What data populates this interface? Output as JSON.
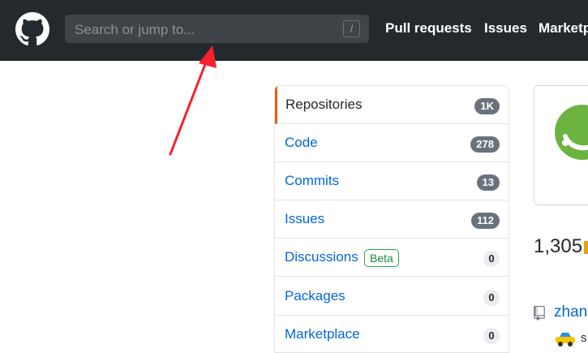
{
  "header": {
    "search_placeholder": "Search or jump to...",
    "search_shortcut": "/",
    "nav": [
      "Pull requests",
      "Issues",
      "Marketplace"
    ]
  },
  "filter_menu": {
    "items": [
      {
        "label": "Repositories",
        "count": "1K",
        "selected": true
      },
      {
        "label": "Code",
        "count": "278"
      },
      {
        "label": "Commits",
        "count": "13"
      },
      {
        "label": "Issues",
        "count": "112"
      },
      {
        "label": "Discussions",
        "badge": "Beta",
        "count": "0"
      },
      {
        "label": "Packages",
        "count": "0"
      },
      {
        "label": "Marketplace",
        "count": "0"
      }
    ]
  },
  "results": {
    "count_text": "1,305",
    "first_repo": "zhan",
    "first_repo_desc": "s"
  },
  "colors": {
    "header_bg": "#24292e",
    "link": "#0366d6",
    "selected_border": "#e36209",
    "arrow": "#f5222d",
    "spring_green": "#6db33f"
  },
  "icons": [
    "github-logo-icon",
    "repo-icon",
    "car-icon",
    "spring-logo-icon"
  ]
}
